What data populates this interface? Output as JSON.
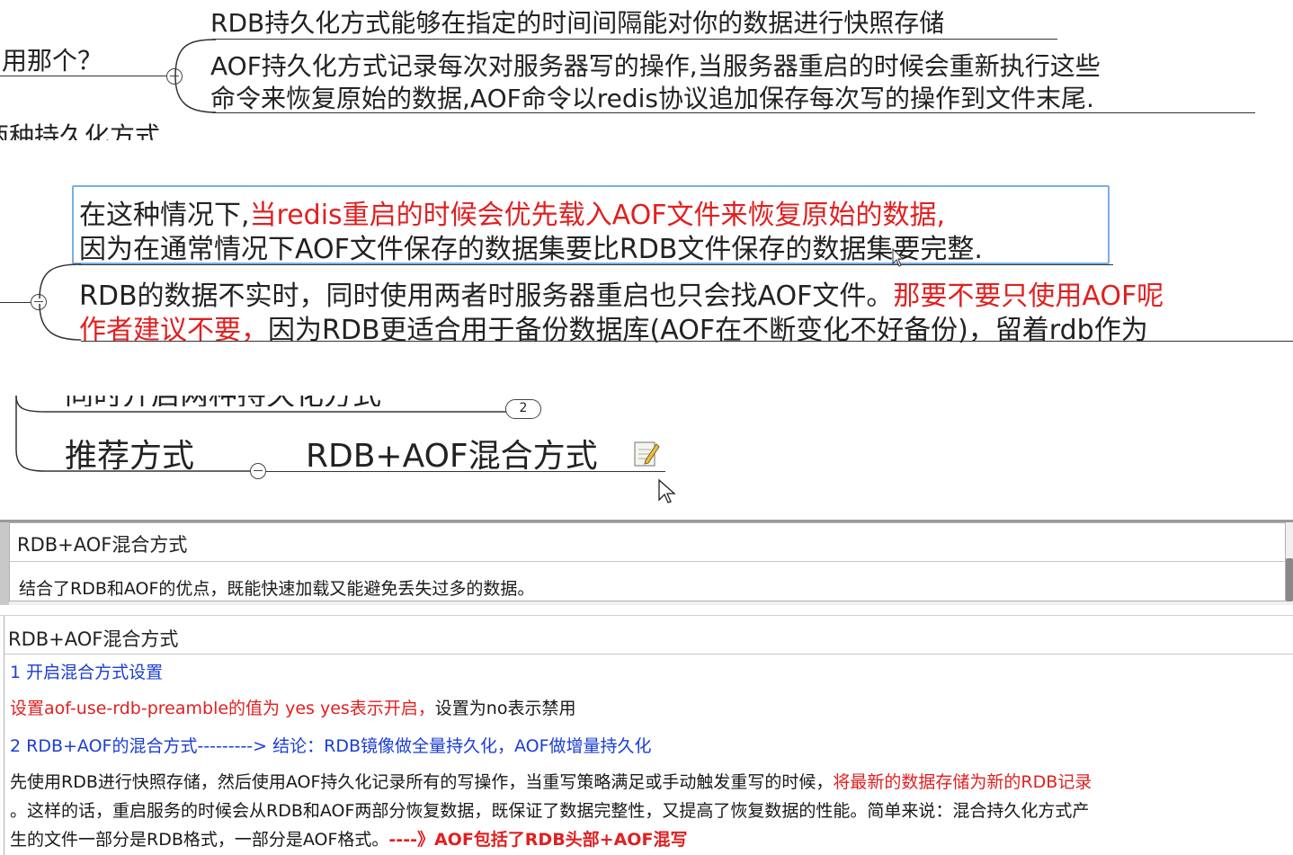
{
  "mindmap_top": {
    "question_label": "用那个？",
    "rdb_desc": "RDB持久化方式能够在指定的时间间隔能对你的数据进行快照存储",
    "aof_desc_line1": "AOF持久化方式记录每次对服务器写的操作,当服务器重启的时候会重新执行这些",
    "aof_desc_line2": "命令来恢复原始的数据,AOF命令以redis协议追加保存每次写的操作到文件末尾.",
    "cut_label": "两种持久化方式"
  },
  "mindmap_mid": {
    "line1_normal": "在这种情况下,",
    "line1_red": "当redis重启的时候会优先载入AOF文件来恢复原始的数据,",
    "line2": "因为在通常情况下AOF文件保存的数据集要比RDB文件保存的数据集要完整.",
    "line3_normal": "RDB的数据不实时，同时使用两者时服务器重启也只会找AOF文件。",
    "line3_red": "那要不要只使用AOF呢",
    "line4_red": "作者建议不要，",
    "line4_normal": "因为RDB更适合用于备份数据库(AOF在不断变化不好备份)，留着rdb作为"
  },
  "mindmap_bottom": {
    "badge_count": "2",
    "cut_text": "同时开启两种持久化方式",
    "recommend_label": "推荐方式",
    "recommend_value": "RDB+AOF混合方式"
  },
  "note_panel_1": {
    "title": "RDB+AOF混合方式",
    "body": "结合了RDB和AOF的优点，既能快速加载又能避免丢失过多的数据。"
  },
  "note_panel_2": {
    "title": "RDB+AOF混合方式",
    "item1": "1 开启混合方式设置",
    "item1_detail_red": "设置aof-use-rdb-preamble的值为 yes    yes表示开启，",
    "item1_detail_normal": "设置为no表示禁用",
    "item2": "2 RDB+AOF的混合方式---------> 结论：RDB镜像做全量持久化，AOF做增量持久化",
    "para_line1_normal": "先使用RDB进行快照存储，然后使用AOF持久化记录所有的写操作，当重写策略满足或手动触发重写的时候，",
    "para_line1_red": "将最新的数据存储为新的RDB记录",
    "para_line2": "。这样的话，重启服务的时候会从RDB和AOF两部分恢复数据，既保证了数据完整性，又提高了恢复数据的性能。简单来说：混合持久化方式产",
    "para_line3_normal": "生的文件一部分是RDB格式，一部分是AOF格式。",
    "para_line3_red": "----》AOF包括了RDB头部+AOF混写"
  },
  "colors": {
    "accent_red": "#e02020",
    "accent_blue": "#1a3dd6",
    "selection_border": "#7aaee6",
    "panel_border": "#a8a8a8"
  }
}
